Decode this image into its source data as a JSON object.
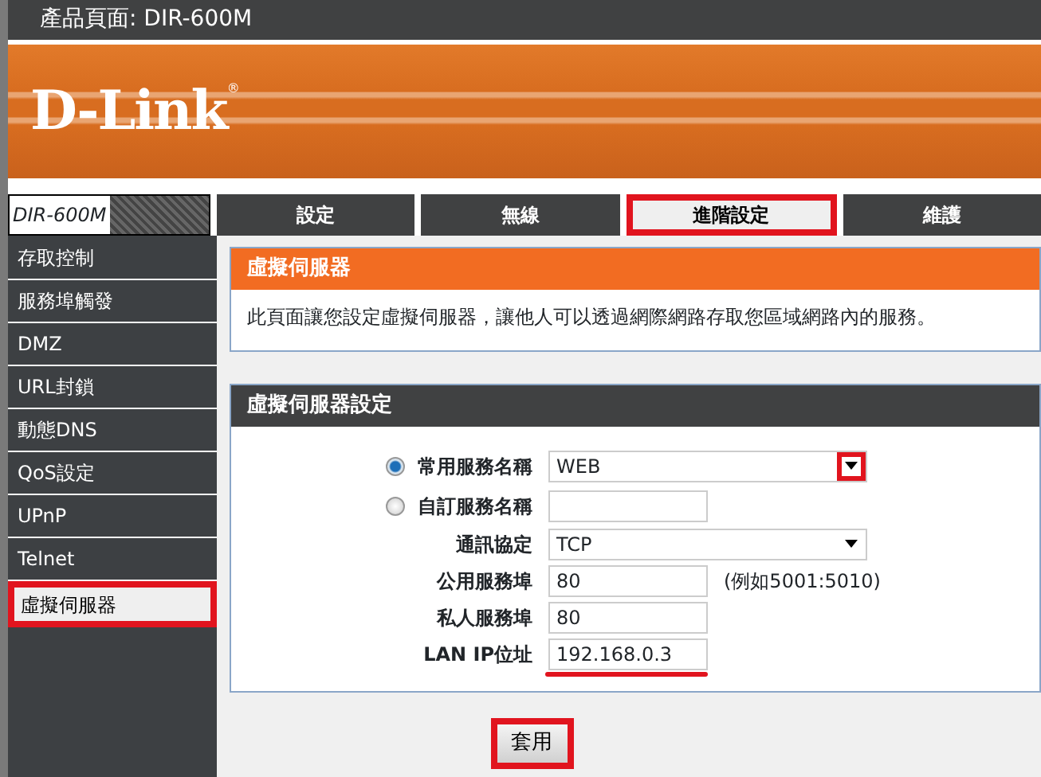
{
  "page_title": "產品頁面: DIR-600M",
  "brand": {
    "name": "D-Link",
    "mark": "®"
  },
  "model_badge": "DIR-600M",
  "tabs": [
    {
      "label": "設定",
      "selected": false,
      "highlighted": false
    },
    {
      "label": "無線",
      "selected": false,
      "highlighted": false
    },
    {
      "label": "進階設定",
      "selected": true,
      "highlighted": true
    },
    {
      "label": "維護",
      "selected": false,
      "highlighted": false
    }
  ],
  "sidebar": {
    "items": [
      {
        "label": "存取控制",
        "selected": false,
        "highlighted": false
      },
      {
        "label": "服務埠觸發",
        "selected": false,
        "highlighted": false
      },
      {
        "label": "DMZ",
        "selected": false,
        "highlighted": false
      },
      {
        "label": "URL封鎖",
        "selected": false,
        "highlighted": false
      },
      {
        "label": "動態DNS",
        "selected": false,
        "highlighted": false
      },
      {
        "label": "QoS設定",
        "selected": false,
        "highlighted": false
      },
      {
        "label": "UPnP",
        "selected": false,
        "highlighted": false
      },
      {
        "label": "Telnet",
        "selected": false,
        "highlighted": false
      },
      {
        "label": "虛擬伺服器",
        "selected": true,
        "highlighted": true
      }
    ]
  },
  "intro": {
    "title": "虛擬伺服器",
    "text": "此頁面讓您設定虛擬伺服器，讓他人可以透過網際網路存取您區域網路內的服務。"
  },
  "settings": {
    "title": "虛擬伺服器設定",
    "rows": [
      {
        "kind": "radio-select",
        "label": "常用服務名稱",
        "checked": true,
        "value": "WEB",
        "arrow_highlighted": true
      },
      {
        "kind": "radio-input",
        "label": "自訂服務名稱",
        "checked": false
      },
      {
        "kind": "select",
        "label": "通訊協定",
        "value": "TCP",
        "arrow_highlighted": false
      },
      {
        "kind": "input",
        "label": "公用服務埠",
        "value": "80",
        "hint": "(例如5001:5010)",
        "underlined": false
      },
      {
        "kind": "input",
        "label": "私人服務埠",
        "value": "80",
        "underlined": false
      },
      {
        "kind": "input",
        "label": "LAN IP位址",
        "value": "192.168.0.3",
        "underlined": true
      }
    ]
  },
  "apply_button": {
    "label": "套用",
    "highlighted": true
  }
}
